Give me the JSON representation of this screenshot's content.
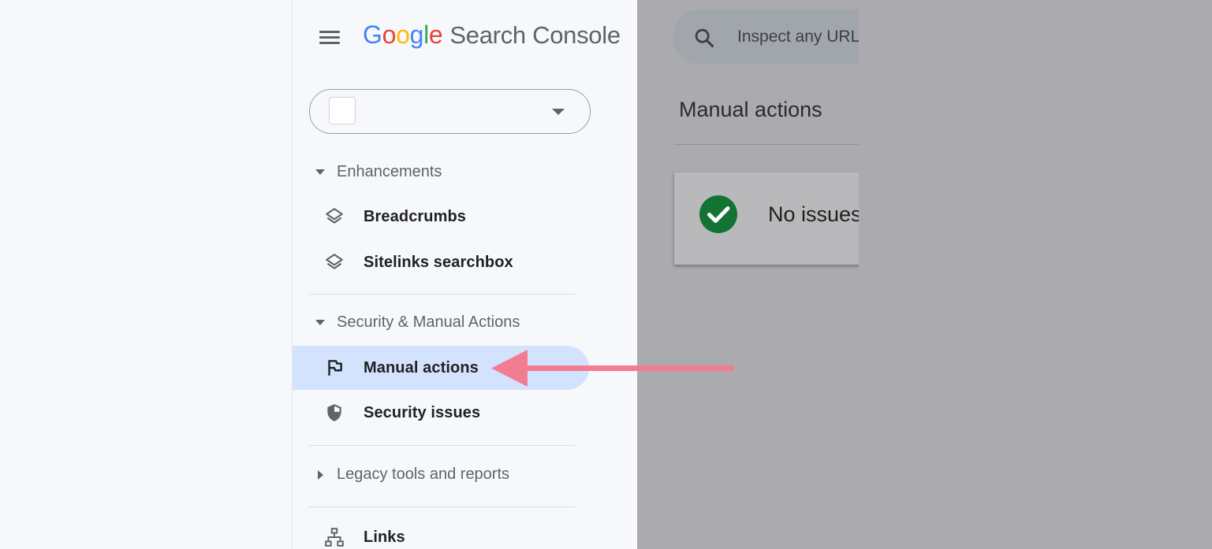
{
  "header": {
    "logo_letters": [
      "G",
      "o",
      "o",
      "g",
      "l",
      "e"
    ],
    "logo_colors": [
      "#4285F4",
      "#EA4335",
      "#FBBC05",
      "#4285F4",
      "#34A853",
      "#EA4335"
    ],
    "product": "Search Console"
  },
  "search": {
    "placeholder": "Inspect any URL in"
  },
  "sidebar": {
    "sections": [
      {
        "title": "Enhancements",
        "expanded": true,
        "items": [
          {
            "label": "Breadcrumbs",
            "icon": "layers-icon"
          },
          {
            "label": "Sitelinks searchbox",
            "icon": "layers-icon"
          }
        ]
      },
      {
        "title": "Security & Manual Actions",
        "expanded": true,
        "items": [
          {
            "label": "Manual actions",
            "icon": "flag-icon",
            "active": true
          },
          {
            "label": "Security issues",
            "icon": "shield-icon"
          }
        ]
      },
      {
        "title": "Legacy tools and reports",
        "expanded": false,
        "items": []
      }
    ],
    "extra_items": [
      {
        "label": "Links",
        "icon": "sitemap-icon"
      }
    ]
  },
  "main": {
    "title": "Manual actions",
    "status_message": "No issues detected"
  },
  "colors": {
    "active_bg": "#d3e3fd",
    "success_green": "#137333",
    "annotation_arrow": "#f27d93",
    "overlay": "#ababaf"
  }
}
